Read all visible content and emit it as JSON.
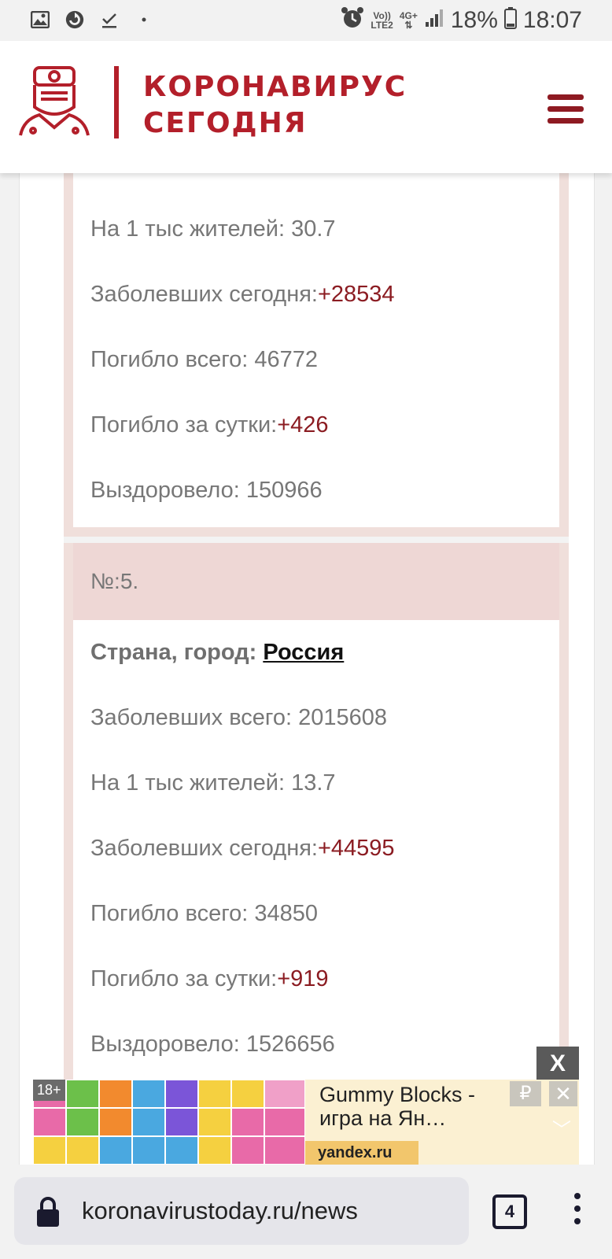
{
  "status_bar": {
    "battery": "18%",
    "time": "18:07",
    "network_top": "Vo))",
    "network_bottom": "LTE2",
    "signal_type": "4G+"
  },
  "header": {
    "logo_line1": "КОРОНАВИРУС",
    "logo_line2": "СЕГОДНЯ"
  },
  "card_prev": {
    "per_thousand": {
      "label": "На 1 тыс жителей: ",
      "value": "30.7"
    },
    "cases_today": {
      "label": "Заболевших сегодня:",
      "value": "+28534"
    },
    "deaths_total": {
      "label": "Погибло всего: ",
      "value": "46772"
    },
    "deaths_today": {
      "label": "Погибло за сутки:",
      "value": "+426"
    },
    "recovered": {
      "label": "Выздоровело: ",
      "value": "150966"
    }
  },
  "card_russia": {
    "number": "№:5.",
    "country_label": "Страна, город: ",
    "country": "Россия",
    "cases_total": {
      "label": "Заболевших всего: ",
      "value": "2015608"
    },
    "per_thousand": {
      "label": "На 1 тыс жителей: ",
      "value": "13.7"
    },
    "cases_today": {
      "label": "Заболевших сегодня:",
      "value": "+44595"
    },
    "deaths_total": {
      "label": "Погибло всего: ",
      "value": "34850"
    },
    "deaths_today": {
      "label": "Погибло за сутки:",
      "value": "+919"
    },
    "recovered": {
      "label": "Выздоровело: ",
      "value": "1526656"
    }
  },
  "ad": {
    "close": "X",
    "age": "18+",
    "title": "Gummy Blocks - игра на Ян…",
    "domain": "yandex.ru",
    "rub": "₽",
    "x": "✕"
  },
  "browser": {
    "url": "koronavirustoday.ru/news",
    "tab_count": "4"
  },
  "colors": {
    "brand_red": "#b31f2a",
    "value_red": "#8b1c22",
    "card_border": "#f0dfdb",
    "card_head": "#eed7d5"
  }
}
